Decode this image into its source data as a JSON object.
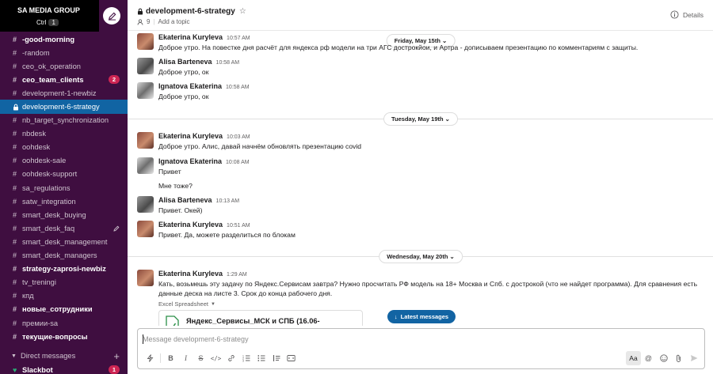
{
  "workspace": {
    "name": "SA MEDIA GROUP",
    "shortcut_label": "Ctrl",
    "shortcut_key": "1"
  },
  "channels": [
    {
      "name": "-good-morning",
      "bold": true
    },
    {
      "name": "-random"
    },
    {
      "name": "ceo_ok_operation"
    },
    {
      "name": "ceo_team_clients",
      "bold": true,
      "badge": "2"
    },
    {
      "name": "development-1-newbiz"
    },
    {
      "name": "development-6-strategy",
      "active": true,
      "private": true
    },
    {
      "name": "nb_target_synchronization"
    },
    {
      "name": "nbdesk"
    },
    {
      "name": "oohdesk"
    },
    {
      "name": "oohdesk-sale"
    },
    {
      "name": "oohdesk-support"
    },
    {
      "name": "sa_regulations"
    },
    {
      "name": "satw_integration"
    },
    {
      "name": "smart_desk_buying"
    },
    {
      "name": "smart_desk_faq",
      "edit": true
    },
    {
      "name": "smart_desk_management"
    },
    {
      "name": "smart_desk_managers"
    },
    {
      "name": "strategy-zaprosi-newbiz",
      "bold": true
    },
    {
      "name": "tv_treningi"
    },
    {
      "name": "кпд"
    },
    {
      "name": "новые_сотрудники",
      "bold": true
    },
    {
      "name": "премии-sa"
    },
    {
      "name": "текущие-вопросы",
      "bold": true
    }
  ],
  "dm_section": {
    "label": "Direct messages",
    "items": [
      {
        "name": "Slackbot",
        "badge": "1"
      }
    ]
  },
  "channel_header": {
    "title": "development-6-strategy",
    "members": "9",
    "topic": "Add a topic",
    "details": "Details"
  },
  "dates": [
    "Friday, May 15th",
    "Tuesday, May 19th",
    "Wednesday, May 20th"
  ],
  "messages": [
    {
      "author": "Ekaterina Kuryleva",
      "time": "10:57 AM",
      "text": "Доброе утро. На повестке дня расчёт для яндекса рф модели на три АГС дострокйои, и Артра - дописываем презентацию по комментариям с защиты."
    },
    {
      "author": "Alisa Barteneva",
      "time": "10:58 AM",
      "text": "Доброе утро, ок"
    },
    {
      "author": "Ignatova Ekaterina",
      "time": "10:58 AM",
      "text": "Доброе утро, ок"
    },
    {
      "author": "Ekaterina Kuryleva",
      "time": "10:03 AM",
      "text": "Доброе утро. Алис, давай начнём обновлять презентацию covid"
    },
    {
      "author": "Ignatova Ekaterina",
      "time": "10:08 AM",
      "text": "Привет",
      "followup": "Мне тоже?"
    },
    {
      "author": "Alisa Barteneva",
      "time": "10:13 AM",
      "text": "Привет. Окей)"
    },
    {
      "author": "Ekaterina Kuryleva",
      "time": "10:51 AM",
      "text": "Привет. Да, можете разделиться по блокам"
    },
    {
      "author": "Ekaterina Kuryleva",
      "time": "1:29 AM",
      "text": "Кать, возьмешь эту задачу по Яндекс.Сервисам завтра? Нужно просчитать РФ модель на 18+ Москва и Спб. с дострокой (что не найдет программа). Для сравнения есть данные деска на листе 3. Срок до конца рабочего дня.",
      "attachment_label": "Excel Spreadsheet",
      "attachment_name": "Яндекс_Сервисы_МСК и СПБ (16.06-"
    }
  ],
  "latest_label": "Latest messages",
  "composer": {
    "placeholder": "Message development-6-strategy",
    "aa": "Aa"
  },
  "colors": {
    "sidebar": "#3f0e40",
    "active": "#1164a3",
    "badge": "#cd2553",
    "presence": "#2bac76",
    "latest": "#1264a3"
  }
}
